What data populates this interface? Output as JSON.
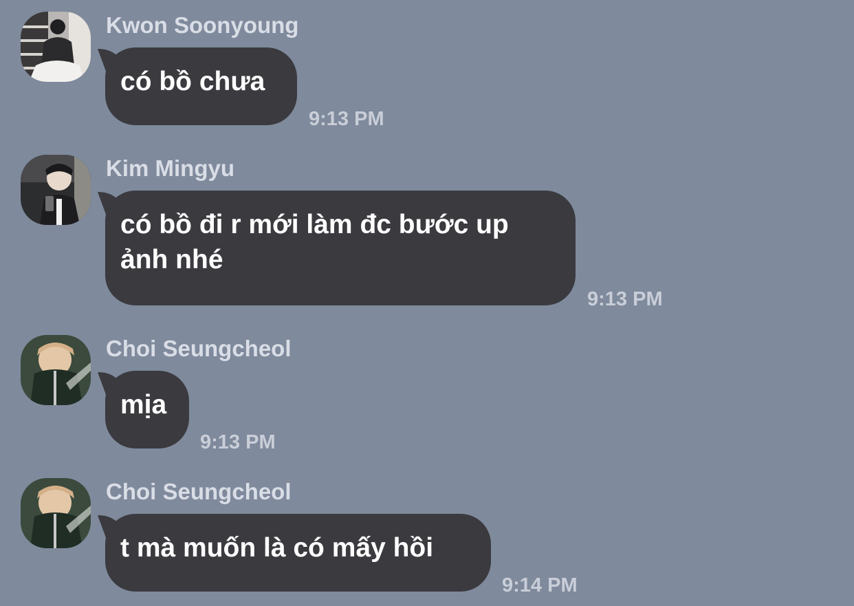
{
  "messages": [
    {
      "sender": "Kwon Soonyoung",
      "text": "có bồ chưa",
      "time": "9:13 PM",
      "avatar_icon": "avatar-soonyoung"
    },
    {
      "sender": "Kim Mingyu",
      "text_line1": "có bồ đi r mới làm đc bước up",
      "text_line2": "ảnh nhé",
      "time": "9:13 PM",
      "avatar_icon": "avatar-mingyu"
    },
    {
      "sender": "Choi Seungcheol",
      "text": "mịa",
      "time": "9:13 PM",
      "avatar_icon": "avatar-seungcheol"
    },
    {
      "sender": "Choi Seungcheol",
      "text": "t mà muốn là có mấy hồi",
      "time": "9:14 PM",
      "avatar_icon": "avatar-seungcheol"
    }
  ],
  "colors": {
    "background": "#7f8a9c",
    "bubble": "#3a3a3f",
    "bubble_text": "#ffffff",
    "sender_text": "#d9dde6",
    "time_text": "#c9ced8"
  }
}
